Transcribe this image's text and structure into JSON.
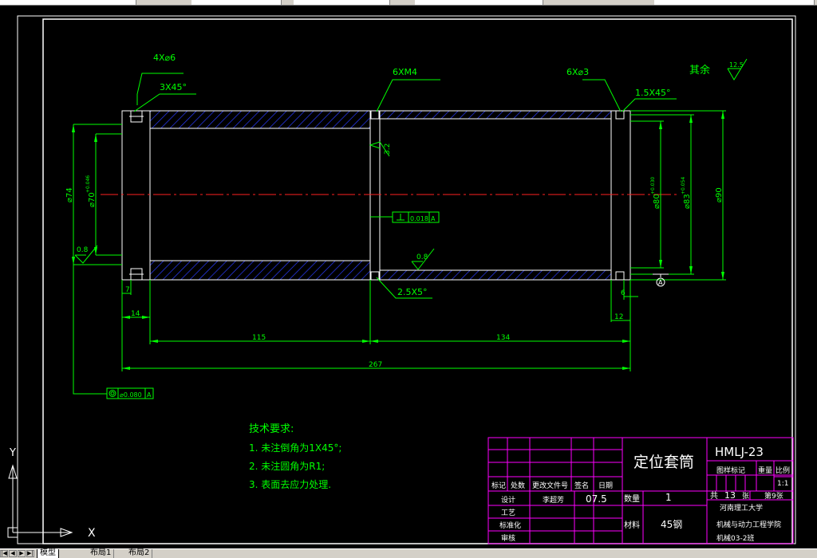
{
  "window": {
    "tabs": [
      "模型",
      "布局1",
      "布局2"
    ]
  },
  "drawing": {
    "callouts": {
      "holes_left": "4X⌀6",
      "chamfer_left": "3X45°",
      "thread_center": "6XM4",
      "holes_right": "6X⌀3",
      "chamfer_right": "1.5X45°",
      "angle_note": "2.5X5°"
    },
    "roughness": {
      "rest_label": "其余",
      "rest_value": "12.5",
      "inner": "3.2",
      "bottom": "0.8",
      "left": "0.8"
    },
    "diameters": {
      "outer_left": "⌀74",
      "inner_left": "⌀70",
      "inner_left_tol": "+0.046",
      "inner_right": "⌀80",
      "inner_right_tol": "+0.030",
      "mid_right": "⌀83",
      "mid_right_tol": "+0.054",
      "outer_right": "⌀90"
    },
    "lengths": {
      "d7": "7",
      "d14": "14",
      "d115": "115",
      "d134": "134",
      "d6": "6",
      "d12": "12",
      "d267": "267"
    },
    "tolerance_frames": {
      "perp_value": "0.018",
      "perp_datum": "A",
      "coax_value": "⌀0.080",
      "coax_datum": "A",
      "datum_marker": "A"
    },
    "tech_requirements": {
      "title": "技术要求:",
      "items": [
        "1. 未注倒角为1X45°;",
        "2. 未注圆角为R1;",
        "3. 表面去应力处理."
      ]
    },
    "ucs": {
      "x_label": "X",
      "y_label": "Y"
    }
  },
  "title_block": {
    "part_name": "定位套筒",
    "drawing_no": "HMLJ-23",
    "header_cells": [
      "标记",
      "处数",
      "更改文件号",
      "签名",
      "日期"
    ],
    "rows": [
      "设计",
      "工艺",
      "标准化",
      "审核"
    ],
    "designer": "李超芳",
    "date": "07.5",
    "qty_label": "数量",
    "qty_value": "1",
    "material_label": "材料",
    "material_value": "45钢",
    "stage_label": "图样标记",
    "weight_label": "重量",
    "scale_label": "比例",
    "scale_value": "1:1",
    "total_prefix": "共",
    "total_value": "13",
    "total_suffix": "张",
    "sheet_value": "第9张",
    "school": "河南理工大学",
    "college": "机械与动力工程学院",
    "class": "机械03-2班"
  }
}
